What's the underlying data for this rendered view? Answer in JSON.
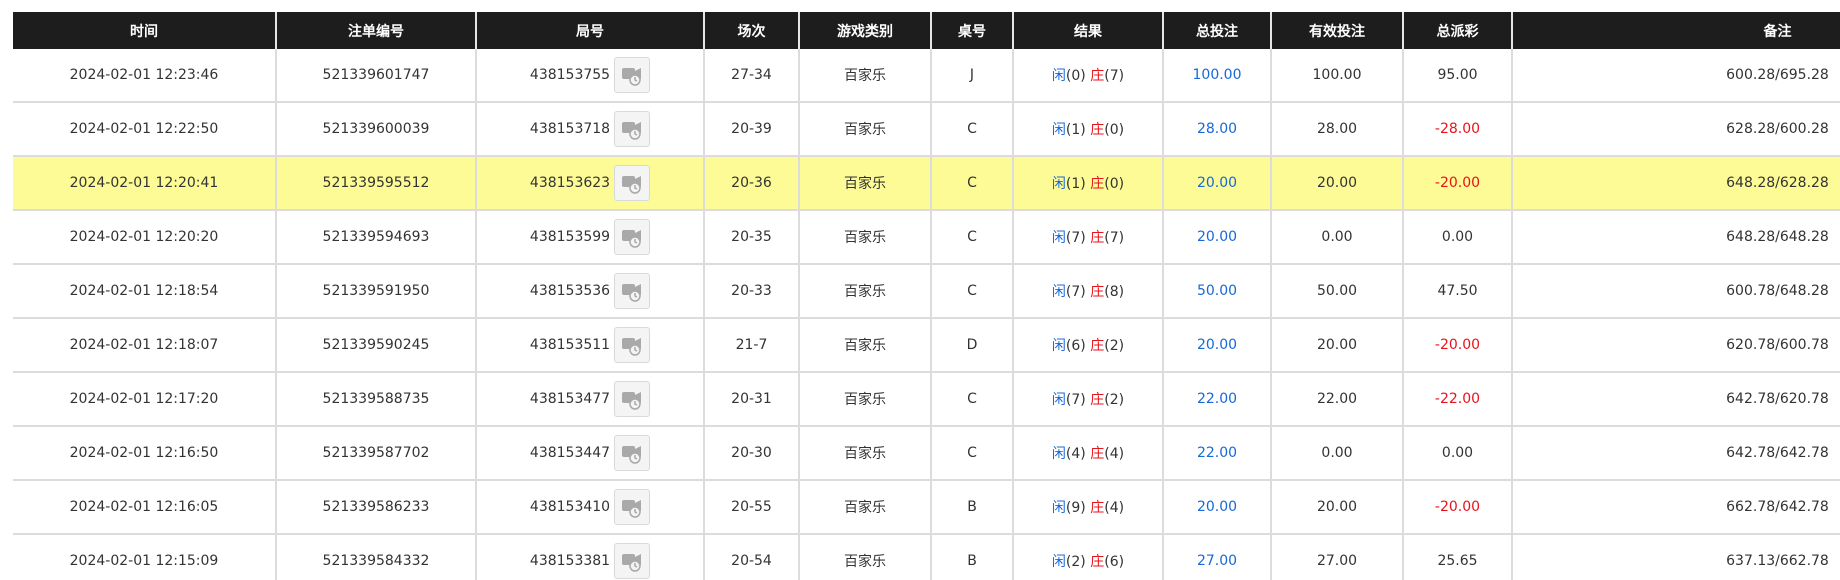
{
  "columns": [
    "时间",
    "注单编号",
    "局号",
    "场次",
    "游戏类别",
    "桌号",
    "结果",
    "总投注",
    "有效投注",
    "总派彩",
    "备注"
  ],
  "result_labels": {
    "player": "闲",
    "banker": "庄"
  },
  "colors": {
    "header_bg": "#1d1d1d",
    "highlight_row": "#fdfb96",
    "blue": "#1768d8",
    "red": "#e8131b"
  },
  "video_icon": "video-replay-icon",
  "rows": [
    {
      "time": "2024-02-01 12:23:46",
      "bet_id": "521339601747",
      "round_id": "438153755",
      "shoe": "27-34",
      "game": "百家乐",
      "table": "J",
      "player": "0",
      "banker": "7",
      "total_bet": "100.00",
      "valid_bet": "100.00",
      "payout": "95.00",
      "payout_negative": false,
      "remark": "600.28/695.28",
      "highlighted": false
    },
    {
      "time": "2024-02-01 12:22:50",
      "bet_id": "521339600039",
      "round_id": "438153718",
      "shoe": "20-39",
      "game": "百家乐",
      "table": "C",
      "player": "1",
      "banker": "0",
      "total_bet": "28.00",
      "valid_bet": "28.00",
      "payout": "-28.00",
      "payout_negative": true,
      "remark": "628.28/600.28",
      "highlighted": false
    },
    {
      "time": "2024-02-01 12:20:41",
      "bet_id": "521339595512",
      "round_id": "438153623",
      "shoe": "20-36",
      "game": "百家乐",
      "table": "C",
      "player": "1",
      "banker": "0",
      "total_bet": "20.00",
      "valid_bet": "20.00",
      "payout": "-20.00",
      "payout_negative": true,
      "remark": "648.28/628.28",
      "highlighted": true
    },
    {
      "time": "2024-02-01 12:20:20",
      "bet_id": "521339594693",
      "round_id": "438153599",
      "shoe": "20-35",
      "game": "百家乐",
      "table": "C",
      "player": "7",
      "banker": "7",
      "total_bet": "20.00",
      "valid_bet": "0.00",
      "payout": "0.00",
      "payout_negative": false,
      "remark": "648.28/648.28",
      "highlighted": false
    },
    {
      "time": "2024-02-01 12:18:54",
      "bet_id": "521339591950",
      "round_id": "438153536",
      "shoe": "20-33",
      "game": "百家乐",
      "table": "C",
      "player": "7",
      "banker": "8",
      "total_bet": "50.00",
      "valid_bet": "50.00",
      "payout": "47.50",
      "payout_negative": false,
      "remark": "600.78/648.28",
      "highlighted": false
    },
    {
      "time": "2024-02-01 12:18:07",
      "bet_id": "521339590245",
      "round_id": "438153511",
      "shoe": "21-7",
      "game": "百家乐",
      "table": "D",
      "player": "6",
      "banker": "2",
      "total_bet": "20.00",
      "valid_bet": "20.00",
      "payout": "-20.00",
      "payout_negative": true,
      "remark": "620.78/600.78",
      "highlighted": false
    },
    {
      "time": "2024-02-01 12:17:20",
      "bet_id": "521339588735",
      "round_id": "438153477",
      "shoe": "20-31",
      "game": "百家乐",
      "table": "C",
      "player": "7",
      "banker": "2",
      "total_bet": "22.00",
      "valid_bet": "22.00",
      "payout": "-22.00",
      "payout_negative": true,
      "remark": "642.78/620.78",
      "highlighted": false
    },
    {
      "time": "2024-02-01 12:16:50",
      "bet_id": "521339587702",
      "round_id": "438153447",
      "shoe": "20-30",
      "game": "百家乐",
      "table": "C",
      "player": "4",
      "banker": "4",
      "total_bet": "22.00",
      "valid_bet": "0.00",
      "payout": "0.00",
      "payout_negative": false,
      "remark": "642.78/642.78",
      "highlighted": false
    },
    {
      "time": "2024-02-01 12:16:05",
      "bet_id": "521339586233",
      "round_id": "438153410",
      "shoe": "20-55",
      "game": "百家乐",
      "table": "B",
      "player": "9",
      "banker": "4",
      "total_bet": "20.00",
      "valid_bet": "20.00",
      "payout": "-20.00",
      "payout_negative": true,
      "remark": "662.78/642.78",
      "highlighted": false
    },
    {
      "time": "2024-02-01 12:15:09",
      "bet_id": "521339584332",
      "round_id": "438153381",
      "shoe": "20-54",
      "game": "百家乐",
      "table": "B",
      "player": "2",
      "banker": "6",
      "total_bet": "27.00",
      "valid_bet": "27.00",
      "payout": "25.65",
      "payout_negative": false,
      "remark": "637.13/662.78",
      "highlighted": false
    }
  ]
}
